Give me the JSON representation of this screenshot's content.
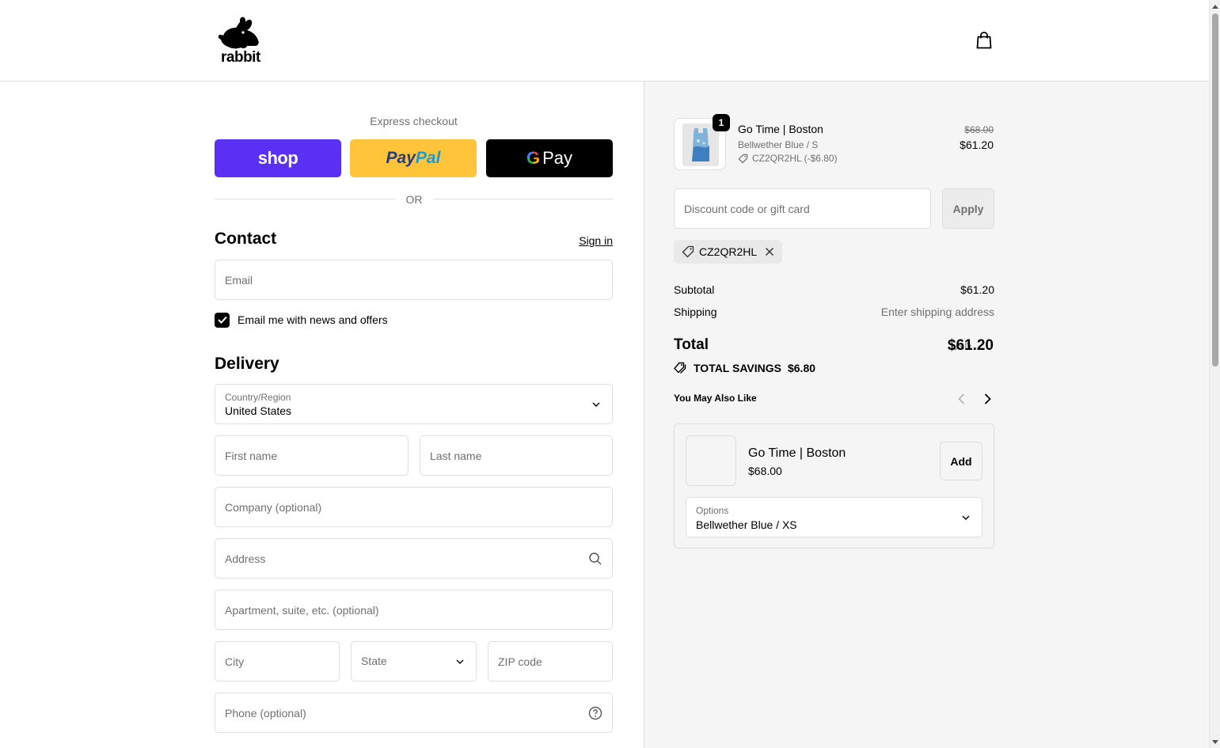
{
  "header": {
    "logo_text": "rabbit",
    "cart_icon": "shopping-bag-icon"
  },
  "express": {
    "title": "Express checkout",
    "shop_label": "shop",
    "paypal_label_1": "Pay",
    "paypal_label_2": "Pal",
    "gpay_g": "G",
    "gpay_label": "Pay",
    "or_label": "OR"
  },
  "contact": {
    "title": "Contact",
    "signin_label": "Sign in",
    "email_placeholder": "Email",
    "email_value": "",
    "newsletter_label": "Email me with news and offers",
    "newsletter_checked": true
  },
  "delivery": {
    "title": "Delivery",
    "country_label": "Country/Region",
    "country_value": "United States",
    "first_name_placeholder": "First name",
    "last_name_placeholder": "Last name",
    "company_placeholder": "Company (optional)",
    "address_placeholder": "Address",
    "apartment_placeholder": "Apartment, suite, etc. (optional)",
    "city_placeholder": "City",
    "state_placeholder": "State",
    "zip_placeholder": "ZIP code",
    "phone_placeholder": "Phone (optional)"
  },
  "order": {
    "item": {
      "quantity": "1",
      "name": "Go Time | Boston",
      "variant": "Bellwether Blue / S",
      "discount": "CZ2QR2HL (-$6.80)",
      "price_original": "$68.00",
      "price_final": "$61.20"
    },
    "discount_placeholder": "Discount code or gift card",
    "apply_label": "Apply",
    "applied_code": "CZ2QR2HL",
    "subtotal_label": "Subtotal",
    "subtotal_value": "$61.20",
    "shipping_label": "Shipping",
    "shipping_value": "Enter shipping address",
    "total_label": "Total",
    "total_currency": "USD",
    "total_value": "$61.20",
    "savings_label": "TOTAL SAVINGS",
    "savings_value": "$6.80"
  },
  "recommendations": {
    "title": "You May Also Like",
    "item": {
      "name": "Go Time | Boston",
      "price": "$68.00",
      "add_label": "Add",
      "options_label": "Options",
      "options_value": "Bellwether Blue / XS"
    }
  },
  "colors": {
    "shop_pay": "#5a31f4",
    "paypal": "#ffc439",
    "gpay": "#000000",
    "sidebar_bg": "#f5f5f5",
    "border": "#dedede"
  }
}
